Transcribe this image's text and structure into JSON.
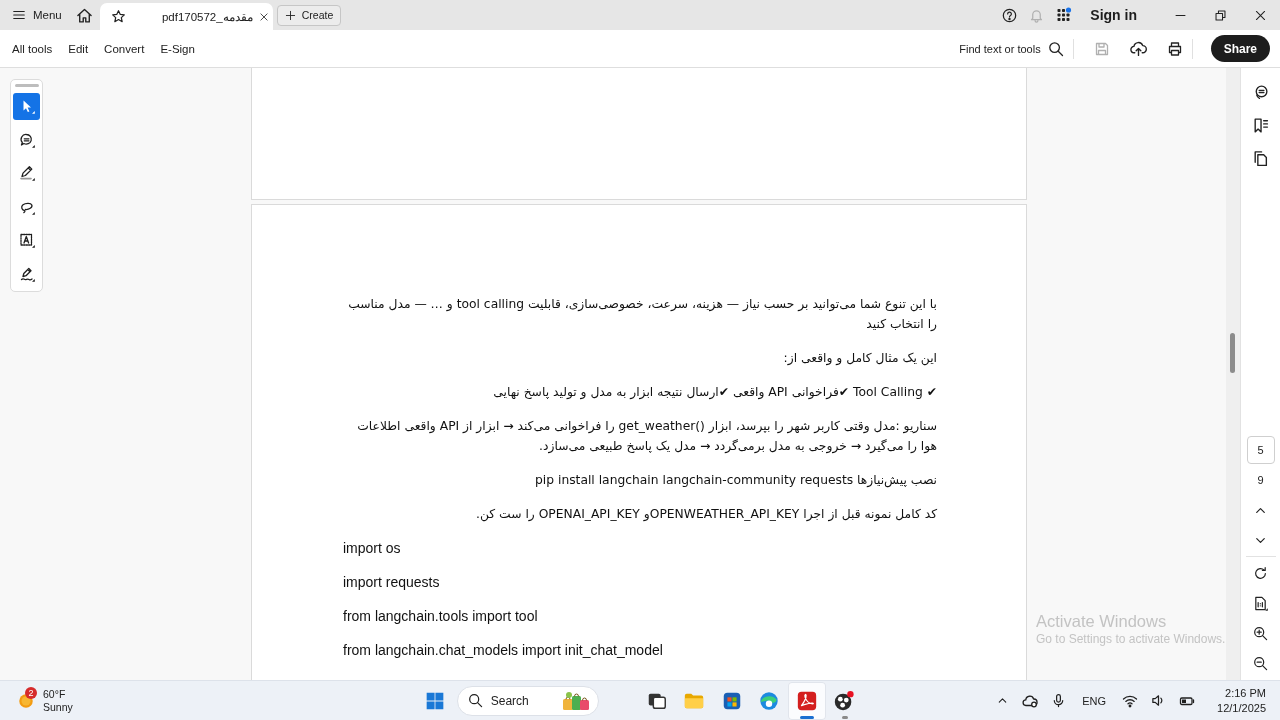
{
  "title_bar": {
    "menu_label": "Menu",
    "tab": {
      "title": "pdf170572_مقدمه",
      "selected": true
    },
    "create_label": "Create",
    "notifications": {
      "disabled": true
    },
    "sign_in": "Sign in"
  },
  "toolbar": {
    "all_tools_label": "All tools",
    "edit_label": "Edit",
    "convert_label": "Convert",
    "esign_label": "E-Sign",
    "find_label": "Find text or tools",
    "save": {
      "disabled": true
    },
    "share_label": "Share"
  },
  "tool_panel": {
    "tools": [
      {
        "selected": true
      },
      {
        "selected": false
      },
      {
        "selected": false
      },
      {
        "selected": false
      },
      {
        "selected": false
      },
      {
        "selected": false
      }
    ]
  },
  "document": {
    "blocks": [
      {
        "kind": "text",
        "text": "با این تنوع شما می‌توانید بر حسب نیاز — هزینه، سرعت، خصوصی‌سازی، قابلیت tool calling و … — مدل مناسب را انتخاب کنید"
      },
      {
        "kind": "text",
        "text": "این یک مثال کامل و واقعی از:"
      },
      {
        "kind": "text",
        "text": "✔ Tool Calling ✔فراخوانی API واقعی  ✔ارسال نتیجه ابزار به مدل و تولید پاسخ نهایی"
      },
      {
        "kind": "text",
        "text": "سناریو :مدل وقتی کاربر شهر را بپرسد، ابزار get_weather() را فراخوانی می‌کند → ابزار از API واقعی اطلاعات هوا را می‌گیرد → خروجی به مدل برمی‌گردد → مدل یک پاسخ طبیعی می‌سازد."
      },
      {
        "kind": "text",
        "text": "نصب پیش‌نیازها pip install langchain langchain-community requests"
      },
      {
        "kind": "text",
        "text": "کد کامل نمونه قبل از اجرا OPENWEATHER_API_KEYو OPENAI_API_KEY را ست کن."
      },
      {
        "kind": "code",
        "text": "import os"
      },
      {
        "kind": "code",
        "text": "import requests"
      },
      {
        "kind": "code",
        "text": "from langchain.tools import tool"
      },
      {
        "kind": "code",
        "text": "from langchain.chat_models import init_chat_model"
      }
    ]
  },
  "page_nav": {
    "current_page": "5",
    "page_count": "9"
  },
  "activation_notice": {
    "title": "Activate Windows",
    "message": "Go to Settings to activate Windows."
  },
  "taskbar": {
    "weather": {
      "badge": "2",
      "temperature": "60°F",
      "condition": "Sunny"
    },
    "search": {
      "placeholder": "Search"
    },
    "apps": [
      {
        "selected": false,
        "running": false
      },
      {
        "selected": false,
        "running": false
      },
      {
        "selected": false,
        "running": false
      },
      {
        "selected": false,
        "running": false
      },
      {
        "selected": true,
        "running": true
      },
      {
        "selected": false,
        "running": true
      }
    ],
    "language": "ENG",
    "time": "2:16 PM",
    "date": "12/1/2025"
  }
}
